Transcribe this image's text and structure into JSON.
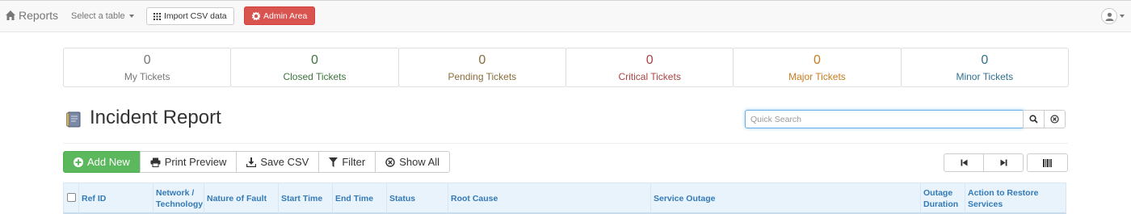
{
  "navbar": {
    "brand": "Reports",
    "table_select": "Select a table",
    "import_label": "Import CSV data",
    "admin_label": "Admin Area"
  },
  "stats": [
    {
      "value": "0",
      "label": "My Tickets",
      "color": "#777777"
    },
    {
      "value": "0",
      "label": "Closed Tickets",
      "color": "#3c763d"
    },
    {
      "value": "0",
      "label": "Pending Tickets",
      "color": "#8a6d3b"
    },
    {
      "value": "0",
      "label": "Critical Tickets",
      "color": "#a94442"
    },
    {
      "value": "0",
      "label": "Major Tickets",
      "color": "#c67c1f"
    },
    {
      "value": "0",
      "label": "Minor Tickets",
      "color": "#31708f"
    }
  ],
  "page": {
    "title": "Incident Report",
    "search_placeholder": "Quick Search"
  },
  "toolbar": {
    "add_new": "Add New",
    "print_preview": "Print Preview",
    "save_csv": "Save CSV",
    "filter": "Filter",
    "show_all": "Show All"
  },
  "table": {
    "columns": [
      "Ref ID",
      "Network / Technology",
      "Nature of Fault",
      "Start Time",
      "End Time",
      "Status",
      "Root Cause",
      "Service Outage",
      "Outage Duration",
      "Action to Restore Services"
    ]
  },
  "colors": {
    "admin": "#d9534f",
    "add_new": "#5cb85c",
    "link": "#337ab7"
  }
}
